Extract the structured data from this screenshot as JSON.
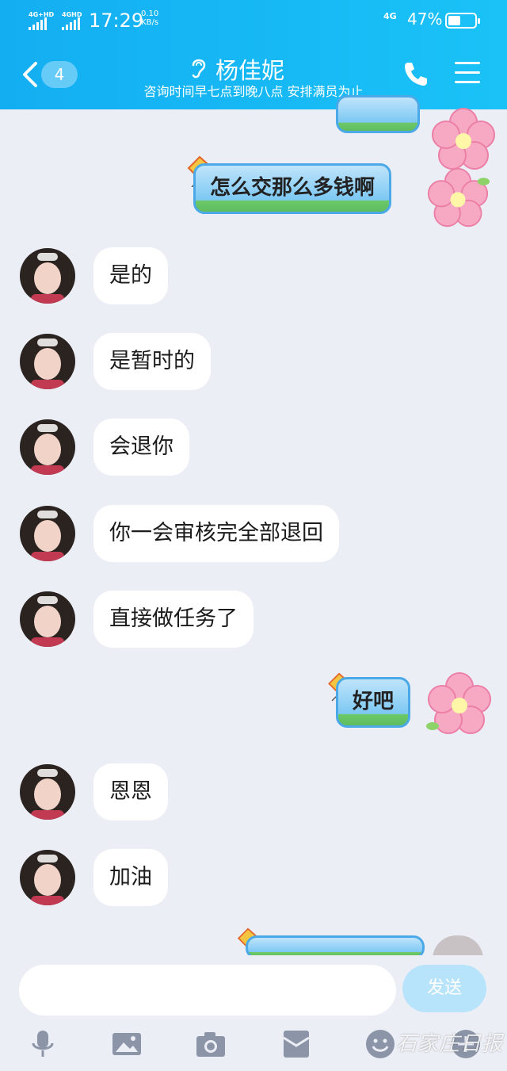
{
  "status_bar": {
    "sig1_label": "4G+HD",
    "sig2_label": "4GHD",
    "time": "17:29",
    "speed_value": "0.10",
    "speed_unit": "KB/s",
    "network": "4G",
    "battery": "47%",
    "battery_level": 0.47
  },
  "header": {
    "unread_count": "4",
    "contact_name": "杨佳妮",
    "subtitle": "咨询时间早七点到晚八点 安排满员为止"
  },
  "messages": [
    {
      "side": "right",
      "style": "kite",
      "text": "怎么交那么多钱啊"
    },
    {
      "side": "left",
      "text": "是的"
    },
    {
      "side": "left",
      "text": "是暂时的"
    },
    {
      "side": "left",
      "text": "会退你"
    },
    {
      "side": "left",
      "text": "你一会审核完全部退回"
    },
    {
      "side": "left",
      "text": "直接做任务了"
    },
    {
      "side": "right",
      "style": "kite",
      "text": "好吧"
    },
    {
      "side": "left",
      "text": "恩恩"
    },
    {
      "side": "left",
      "text": "加油"
    }
  ],
  "input": {
    "placeholder": "",
    "send_label": "发送"
  },
  "toolbar": {
    "icons": [
      "microphone-icon",
      "image-icon",
      "camera-icon",
      "red-packet-icon",
      "emoji-icon",
      "plus-icon"
    ]
  },
  "watermark": "石家庄日报",
  "colors": {
    "header": "#13aef2",
    "background": "#eceef6",
    "send_button": "#b8e4fb"
  }
}
